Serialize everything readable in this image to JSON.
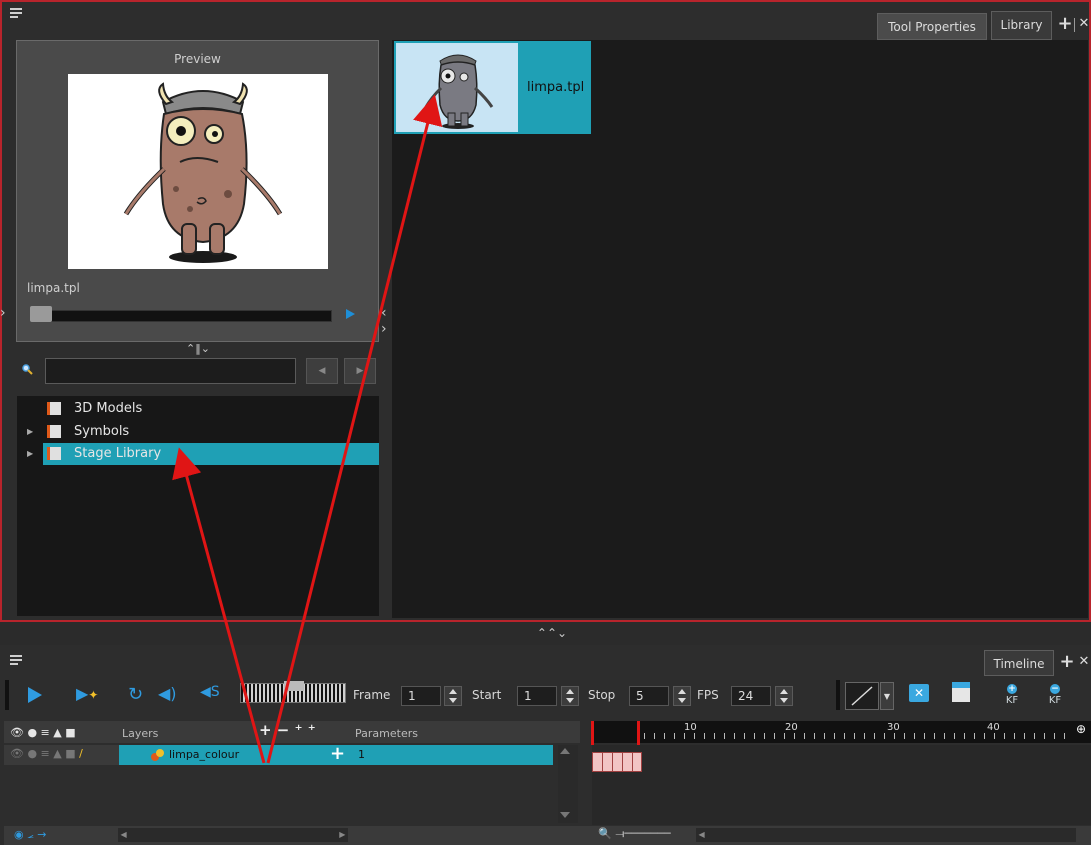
{
  "library_panel": {
    "tabs": [
      {
        "label": "Tool Properties"
      },
      {
        "label": "Library"
      }
    ],
    "preview": {
      "title": "Preview",
      "filename": "limpa.tpl"
    },
    "tree": [
      {
        "label": "3D Models",
        "expandable": false
      },
      {
        "label": "Symbols",
        "expandable": true
      },
      {
        "label": "Stage Library",
        "expandable": true,
        "selected": true
      }
    ],
    "items": [
      {
        "label": "limpa.tpl"
      }
    ]
  },
  "timeline_panel": {
    "tab": "Timeline",
    "toolbar": {
      "frame_label": "Frame",
      "frame_value": "1",
      "start_label": "Start",
      "start_value": "1",
      "stop_label": "Stop",
      "stop_value": "5",
      "fps_label": "FPS",
      "fps_value": "24",
      "kf_labels": [
        "KF",
        "KF"
      ]
    },
    "layers_header": "Layers",
    "parameters_header": "Parameters",
    "layers": [
      {
        "name": "limpa_colour",
        "parameter": "1"
      }
    ],
    "ruler": [
      "10",
      "20",
      "30",
      "40"
    ]
  },
  "colors": {
    "selection": "#1fa0b5",
    "annotation_arrow": "#e01515",
    "panel_border": "#b8242c"
  }
}
